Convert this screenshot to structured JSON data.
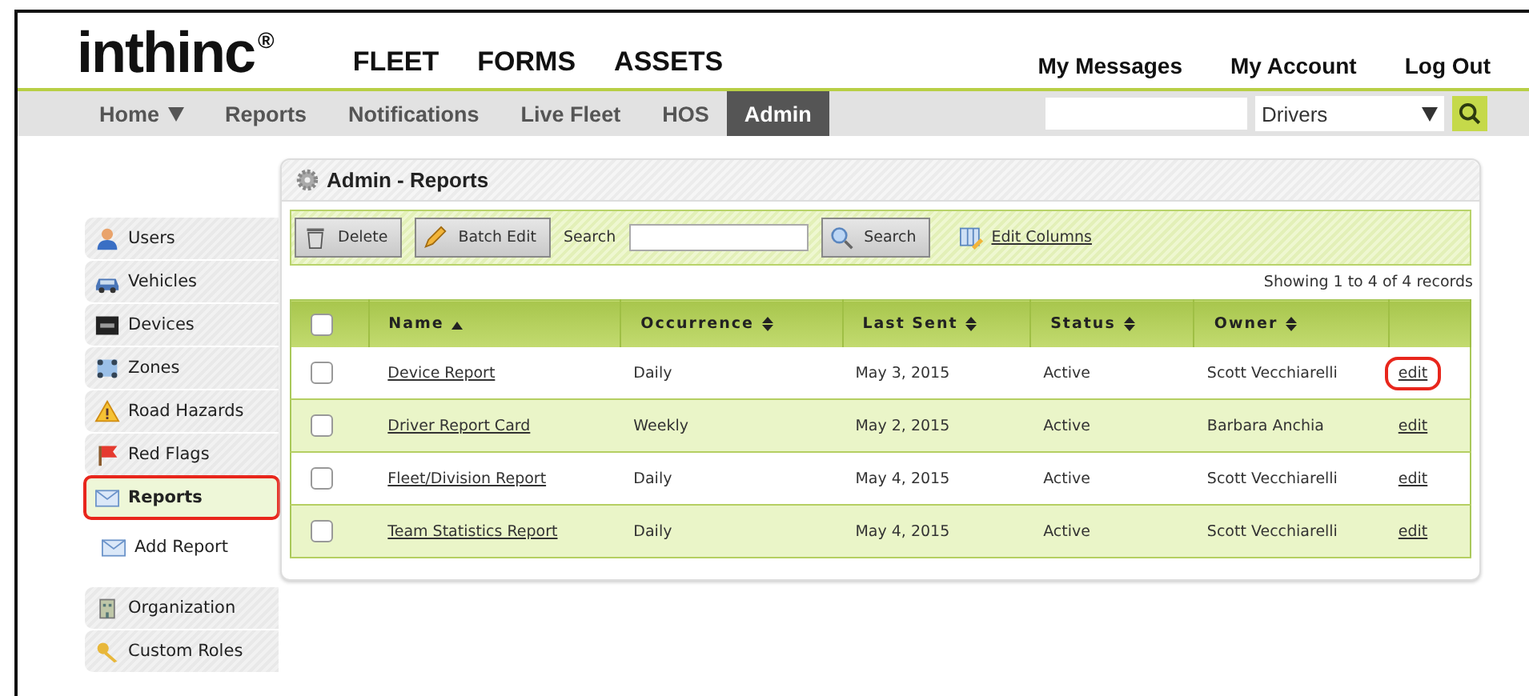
{
  "logo": {
    "text": "inthinc",
    "mark": "®"
  },
  "top_nav": [
    "FLEET",
    "FORMS",
    "ASSETS"
  ],
  "account_links": [
    "My Messages",
    "My Account",
    "Log Out"
  ],
  "nav_tabs": [
    {
      "label": "Home",
      "dropdown": true,
      "selected": false
    },
    {
      "label": "Reports",
      "dropdown": false,
      "selected": false
    },
    {
      "label": "Notifications",
      "dropdown": false,
      "selected": false
    },
    {
      "label": "Live Fleet",
      "dropdown": false,
      "selected": false
    },
    {
      "label": "HOS",
      "dropdown": false,
      "selected": false
    },
    {
      "label": "Admin",
      "dropdown": false,
      "selected": true
    }
  ],
  "global_search": {
    "scope": "Drivers"
  },
  "sidebar": {
    "groups": [
      [
        {
          "label": "Users",
          "selected": false,
          "highlighted": false,
          "kind": "tab"
        },
        {
          "label": "Vehicles",
          "selected": false,
          "highlighted": false,
          "kind": "tab"
        },
        {
          "label": "Devices",
          "selected": false,
          "highlighted": false,
          "kind": "tab"
        },
        {
          "label": "Zones",
          "selected": false,
          "highlighted": false,
          "kind": "tab"
        },
        {
          "label": "Road Hazards",
          "selected": false,
          "highlighted": false,
          "kind": "tab"
        },
        {
          "label": "Red Flags",
          "selected": false,
          "highlighted": false,
          "kind": "tab"
        },
        {
          "label": "Reports",
          "selected": true,
          "highlighted": true,
          "kind": "tab"
        },
        {
          "label": "Add Report",
          "selected": false,
          "highlighted": false,
          "kind": "link"
        }
      ],
      [
        {
          "label": "Organization",
          "selected": false,
          "highlighted": false,
          "kind": "tab"
        },
        {
          "label": "Custom Roles",
          "selected": false,
          "highlighted": false,
          "kind": "tab"
        }
      ]
    ]
  },
  "panel": {
    "title": "Admin - Reports",
    "toolbar": {
      "delete": "Delete",
      "batch_edit": "Batch Edit",
      "search_label": "Search",
      "search_button": "Search",
      "edit_columns": "Edit Columns"
    },
    "record_count": "Showing 1 to 4 of 4 records",
    "table": {
      "select_all_checked": false,
      "columns": [
        {
          "label": "Name",
          "sorted": true
        },
        {
          "label": "Occurrence",
          "sorted": false
        },
        {
          "label": "Last Sent",
          "sorted": false
        },
        {
          "label": "Status",
          "sorted": false
        },
        {
          "label": "Owner",
          "sorted": false
        }
      ],
      "rows": [
        {
          "checked": false,
          "name": "Device Report",
          "occurrence": "Daily",
          "last_sent": "May 3, 2015",
          "status": "Active",
          "owner": "Scott Vecchiarelli",
          "action": "edit",
          "highlighted": true
        },
        {
          "checked": false,
          "name": "Driver Report Card",
          "occurrence": "Weekly",
          "last_sent": "May 2, 2015",
          "status": "Active",
          "owner": "Barbara Anchia",
          "action": "edit",
          "highlighted": false
        },
        {
          "checked": false,
          "name": "Fleet/Division Report",
          "occurrence": "Daily",
          "last_sent": "May 4, 2015",
          "status": "Active",
          "owner": "Scott Vecchiarelli",
          "action": "edit",
          "highlighted": false
        },
        {
          "checked": false,
          "name": "Team Statistics Report",
          "occurrence": "Daily",
          "last_sent": "May 4, 2015",
          "status": "Active",
          "owner": "Scott Vecchiarelli",
          "action": "edit",
          "highlighted": false
        }
      ]
    }
  }
}
